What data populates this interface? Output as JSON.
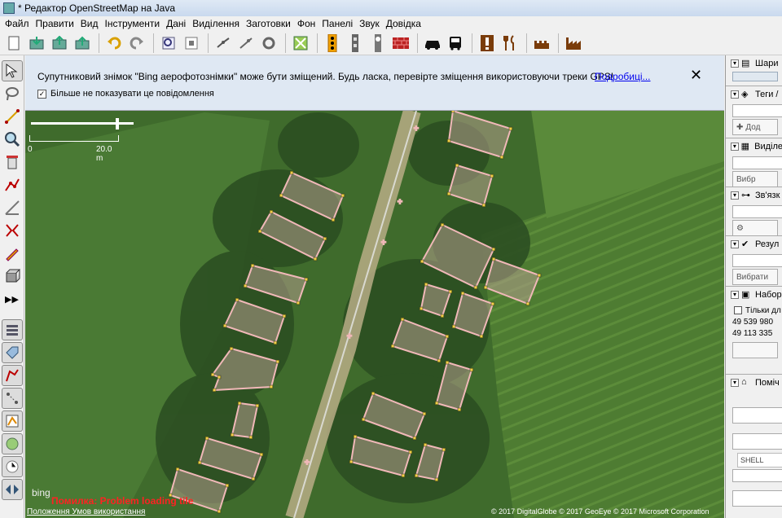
{
  "window": {
    "title": "* Редактор OpenStreetMap на Java"
  },
  "menu": [
    "Файл",
    "Правити",
    "Вид",
    "Інструменти",
    "Дані",
    "Виділення",
    "Заготовки",
    "Фон",
    "Панелі",
    "Звук",
    "Довідка"
  ],
  "toolbar": [
    "new-file-icon",
    "open-file-icon",
    "save-icon",
    "upload-icon",
    "undo-icon",
    "redo-icon",
    "preferences-icon",
    "zoom-to-data-icon",
    "split-way-icon",
    "combine-way-icon",
    "reverse-way-icon",
    "paste-tags-icon",
    "preset-traffic-signal-icon",
    "preset-street-lamp-icon",
    "preset-parking-meter-icon",
    "preset-wall-icon",
    "preset-car-icon",
    "preset-bus-icon",
    "preset-warning-icon",
    "preset-restaurant-icon",
    "preset-castle-icon",
    "preset-factory-icon"
  ],
  "notice": {
    "message": "Супутниковий знімок \"Bing аерофотознімки\" може бути зміщений. Будь ласка, перевірте зміщення використовуючи треки GPS!",
    "more_link": "Подробиці...",
    "close": "✕",
    "checkbox_label": "Більше не показувати це повідомлення",
    "checkbox_mark": "✓"
  },
  "scale": {
    "zero": "0",
    "length": "20.0 m"
  },
  "map_overlay": {
    "bing": "bing",
    "error": "Помилка: Problem loading tile",
    "terms": "Положення Умов використання",
    "attribution": "© 2017 DigitalGlobe © 2017 GeoEye © 2017 Microsoft Corporation"
  },
  "panels": {
    "layers": {
      "title": "Шари"
    },
    "tags": {
      "title": "Теги /",
      "button": "Дод"
    },
    "selection": {
      "title": "Виділе",
      "button": "Вибр"
    },
    "relations": {
      "title": "Зв'язк"
    },
    "results": {
      "title": "Резул",
      "button": "Вибрати"
    },
    "changesets": {
      "title": "Набор",
      "checkbox": "Тільки дл",
      "rows": [
        "49 539 980",
        "49 113 335"
      ]
    },
    "history": {
      "title": "Поміч",
      "shell": "SHELL"
    }
  },
  "colors": {
    "building_outline": "#f0b8b8",
    "node": "#ffe000",
    "road": "#c9c0a0"
  }
}
